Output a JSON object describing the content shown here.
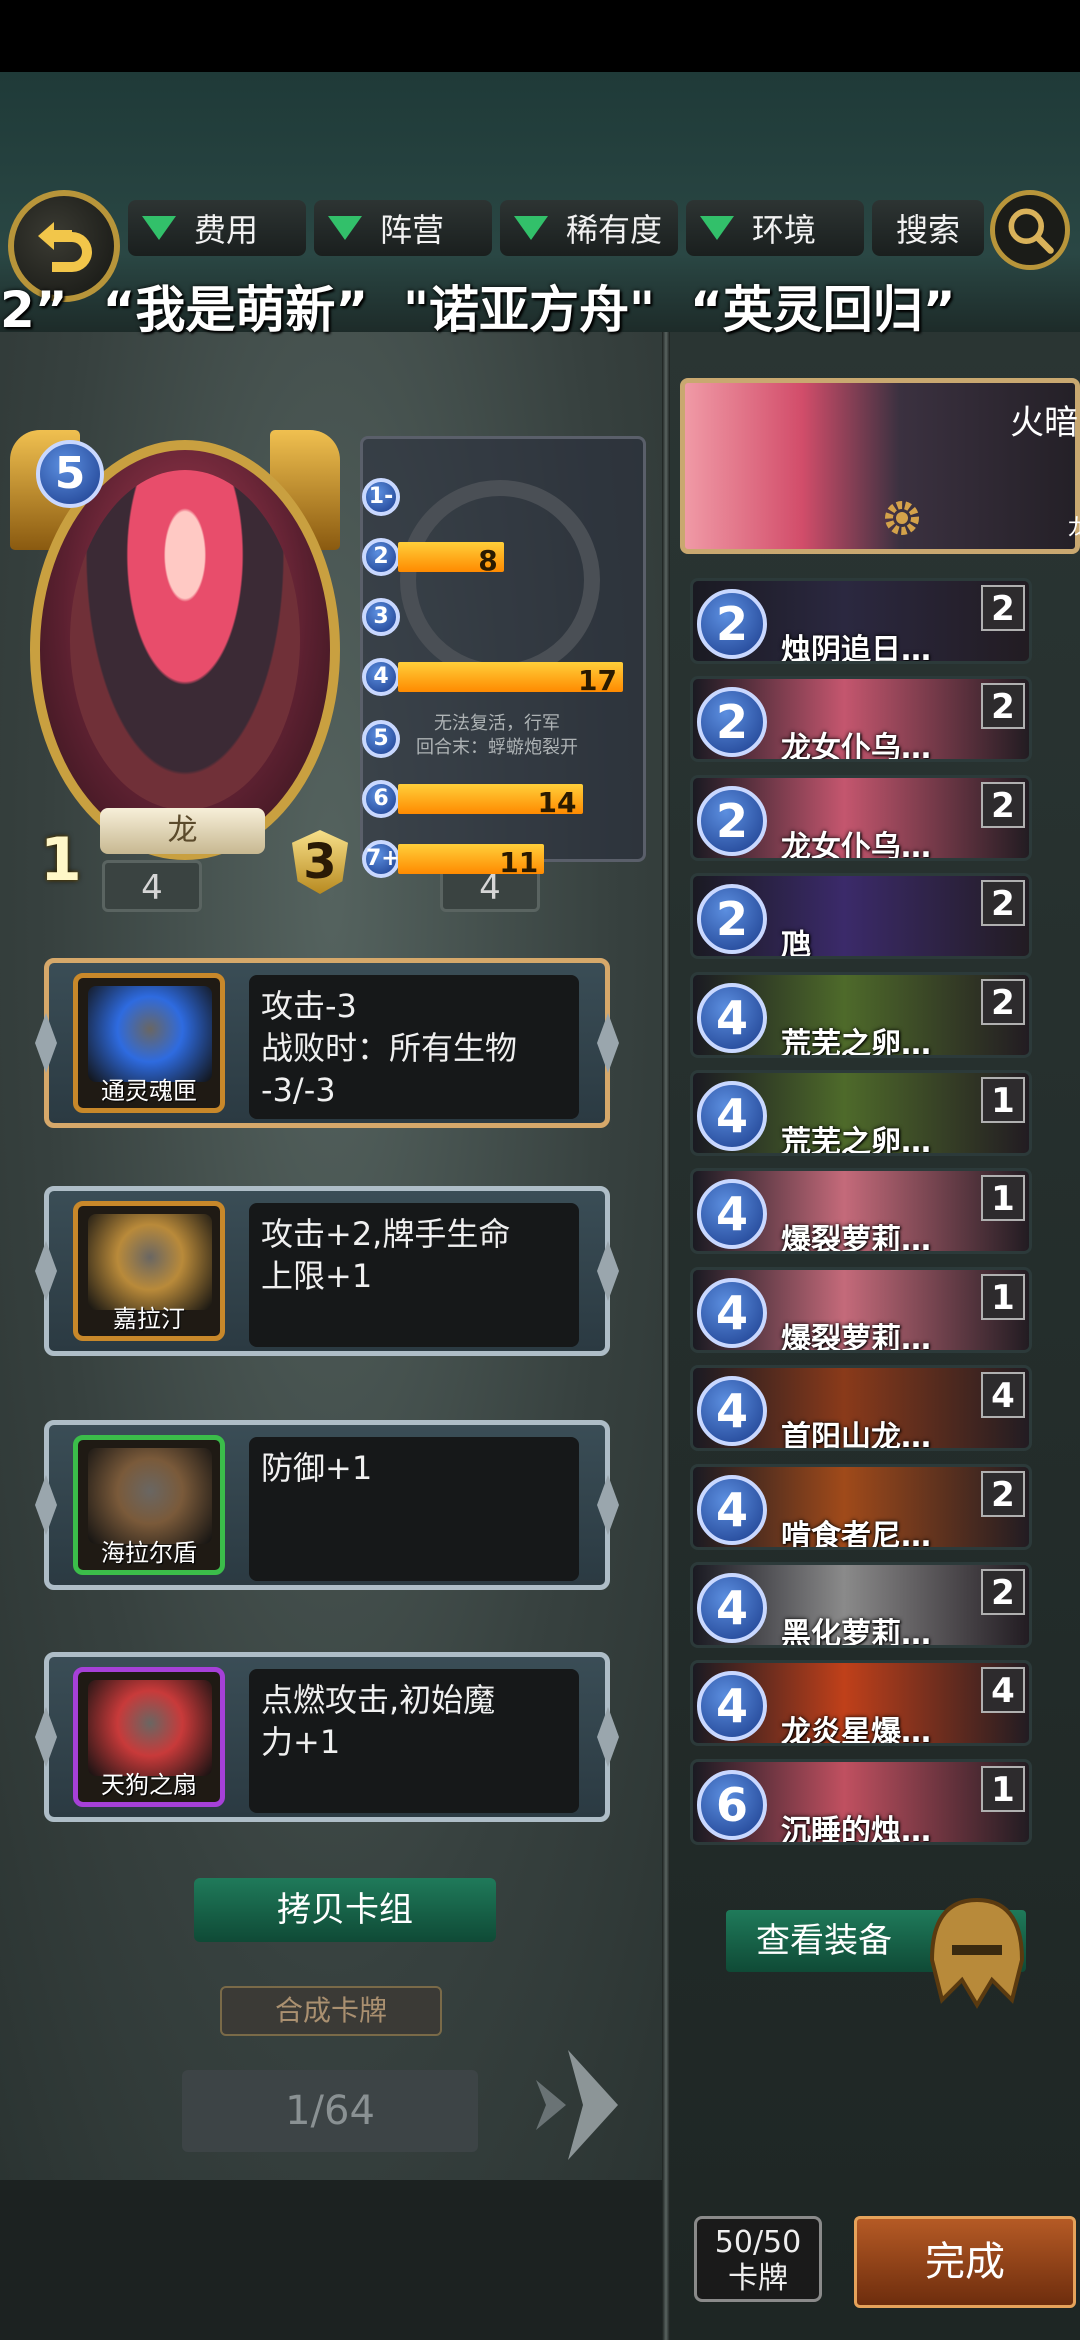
{
  "filters": [
    {
      "label": "费用"
    },
    {
      "label": "阵营"
    },
    {
      "label": "稀有度"
    },
    {
      "label": "环境"
    }
  ],
  "search_label": "搜索",
  "subtitle": "2”  “我是萌新”  \"诺亚方舟\"  “英灵回归”",
  "hero": {
    "cost": "5",
    "attack": "1",
    "health": "3",
    "faction": "龙"
  },
  "ghost_text": "无法复活，行军\n回合末：蜉蝣炮裂开",
  "slots": [
    "4",
    "4"
  ],
  "mana_curve": [
    {
      "cost": "1-",
      "count": "",
      "fraction": 0
    },
    {
      "cost": "2",
      "count": "8",
      "fraction": 0.47
    },
    {
      "cost": "3",
      "count": "",
      "fraction": 0
    },
    {
      "cost": "4",
      "count": "17",
      "fraction": 1.0
    },
    {
      "cost": "5",
      "count": "",
      "fraction": 0
    },
    {
      "cost": "6",
      "count": "14",
      "fraction": 0.82
    },
    {
      "cost": "7+",
      "count": "11",
      "fraction": 0.65
    }
  ],
  "equipment": [
    {
      "name": "通灵魂匣",
      "desc": "攻击-3\n战败时：所有生物\n-3/-3",
      "border": "#c8882a",
      "pic": "#2e6be0"
    },
    {
      "name": "嘉拉汀",
      "desc": "攻击+2,牌手生命\n上限+1",
      "border": "#c8882a",
      "pic": "#b98a3a"
    },
    {
      "name": "海拉尔盾",
      "desc": "防御+1",
      "border": "#3bbd4a",
      "pic": "#7a5a3a"
    },
    {
      "name": "天狗之扇",
      "desc": "点燃攻击,初始魔\n力+1",
      "border": "#a640d8",
      "pic": "#c83a3a"
    }
  ],
  "copy_deck_label": "拷贝卡组",
  "craft_label": "合成卡牌",
  "page_indicator": "1/64",
  "hero_name": "火暗",
  "hero_faction": "龙",
  "deck": [
    {
      "cost": "2",
      "name": "烛阴追日…",
      "qty": "2",
      "art": "#2b2840"
    },
    {
      "cost": "2",
      "name": "龙女仆乌…",
      "qty": "2",
      "art": "#c4566e"
    },
    {
      "cost": "2",
      "name": "龙女仆乌…",
      "qty": "2",
      "art": "#c4566e"
    },
    {
      "cost": "2",
      "name": "虺",
      "qty": "2",
      "art": "#3b2a6a"
    },
    {
      "cost": "4",
      "name": "荒芜之卵…",
      "qty": "2",
      "art": "#4e6a2a"
    },
    {
      "cost": "4",
      "name": "荒芜之卵…",
      "qty": "1",
      "art": "#4e6a2a"
    },
    {
      "cost": "4",
      "name": "爆裂萝莉…",
      "qty": "1",
      "art": "#c46a7a"
    },
    {
      "cost": "4",
      "name": "爆裂萝莉…",
      "qty": "1",
      "art": "#c46a7a"
    },
    {
      "cost": "4",
      "name": "首阳山龙…",
      "qty": "4",
      "art": "#8a3a1a"
    },
    {
      "cost": "4",
      "name": "啃食者尼…",
      "qty": "2",
      "art": "#a04a1a"
    },
    {
      "cost": "4",
      "name": "黑化萝莉…",
      "qty": "2",
      "art": "#8a8a8a"
    },
    {
      "cost": "4",
      "name": "龙炎星爆…",
      "qty": "4",
      "art": "#c0401a"
    },
    {
      "cost": "6",
      "name": "沉睡的烛…",
      "qty": "1",
      "art": "#c05060"
    }
  ],
  "view_equip_label": "查看装备",
  "card_count": "50/50",
  "card_count_label": "卡牌",
  "done_label": "完成"
}
